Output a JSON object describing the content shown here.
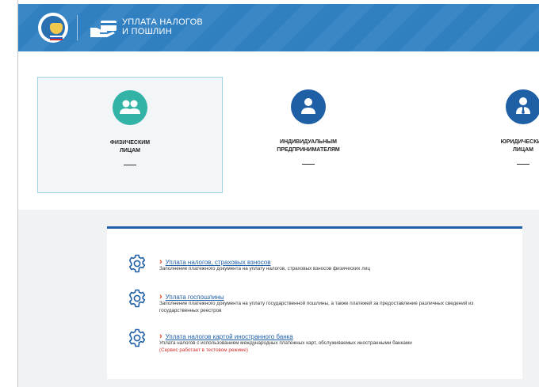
{
  "header": {
    "title_line1": "УПЛАТА НАЛОГОВ",
    "title_line2": "И ПОШЛИН"
  },
  "categories": [
    {
      "label_line1": "ФИЗИЧЕСКИМ",
      "label_line2": "ЛИЦАМ",
      "color": "#33b3a6",
      "active": true,
      "icon": "people-icon"
    },
    {
      "label_line1": "ИНДИВИДУАЛЬНЫМ",
      "label_line2": "ПРЕДПРИНИМАТЕЛЯМ",
      "color": "#1f5fa6",
      "active": false,
      "icon": "person-icon"
    },
    {
      "label_line1": "ЮРИДИЧЕСКИМ",
      "label_line2": "ЛИЦАМ",
      "color": "#1f5fa6",
      "active": false,
      "icon": "businessman-icon"
    }
  ],
  "services": [
    {
      "link": "Уплата налогов, страховых взносов",
      "description": "Заполнение платежного документа на уплату налогов, страховых взносов физических лиц",
      "note": ""
    },
    {
      "link": "Уплата госпошлины",
      "description": "Заполнение платежного документа на уплату государственной пошлины, а также платежей за предоставление различных сведений из государственных реестров",
      "note": ""
    },
    {
      "link": "Уплата налогов картой иностранного банка",
      "description": "Уплата налогов с использованием международных платежных карт, обслуживаемых иностранными банками",
      "note": "(Сервис работает в тестовом режиме)"
    }
  ],
  "colors": {
    "header_blue": "#2f7fc1",
    "accent_teal": "#33b3a6",
    "accent_blue": "#1f5fa6",
    "link_chevron": "#e0471f",
    "note_red": "#d32f2f"
  }
}
